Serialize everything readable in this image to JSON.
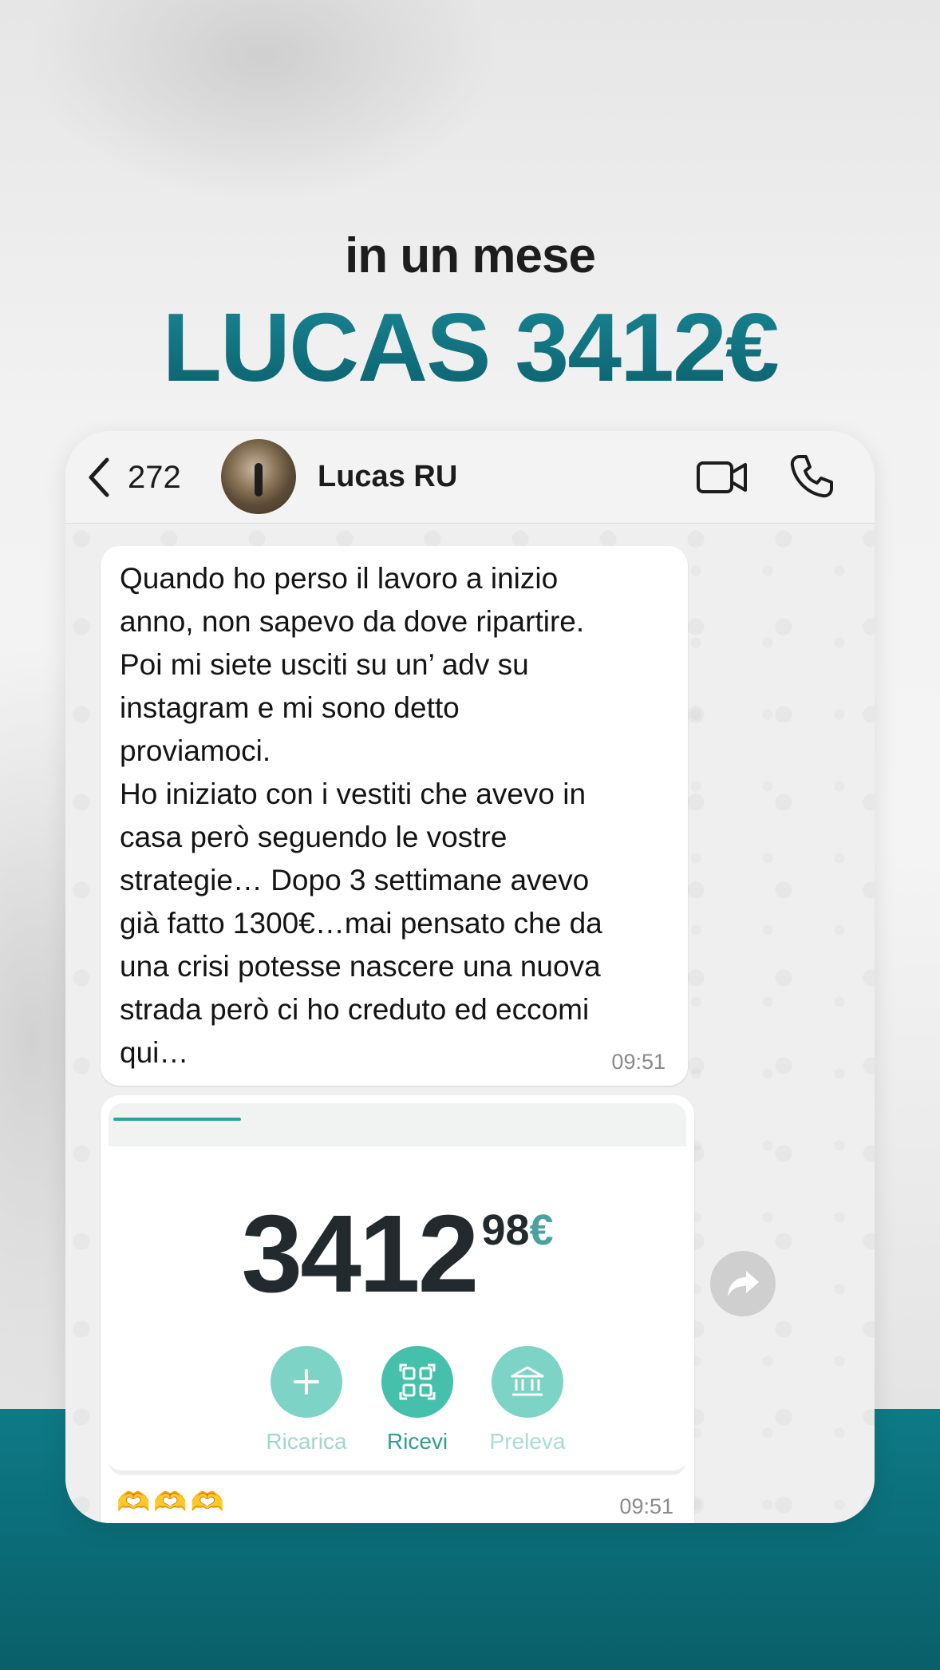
{
  "headline": {
    "line1": "in un mese",
    "line2": "LUCAS 3412€"
  },
  "chat_header": {
    "back_count": "272",
    "contact_name": "Lucas RU",
    "icons": [
      "chevron-left-icon",
      "video-call-icon",
      "phone-icon"
    ]
  },
  "messages": [
    {
      "text": "Quando ho perso il lavoro a inizio\nanno, non sapevo da dove ripartire.\nPoi mi siete usciti su un’ adv su\ninstagram e mi sono detto\nproviamoci.\nHo iniziato con i vestiti che avevo in\ncasa però seguendo le vostre\nstrategie… Dopo 3 settimane avevo\ngià fatto 1300€…mai pensato che da\nuna crisi potesse nascere una nuova\nstrada però ci ho creduto ed eccomi\nqui…",
      "time": "09:51"
    },
    {
      "balance_main": "3412",
      "balance_cents": "98",
      "balance_currency": "€",
      "actions": [
        "Ricarica",
        "Ricevi",
        "Preleva"
      ],
      "emojis": "🫶🫶🫶",
      "time": "09:51"
    }
  ],
  "colors": {
    "accent_teal": "#0f6b78",
    "wallet_green": "#44c0ab",
    "bottom_band": "#0b6b76"
  }
}
